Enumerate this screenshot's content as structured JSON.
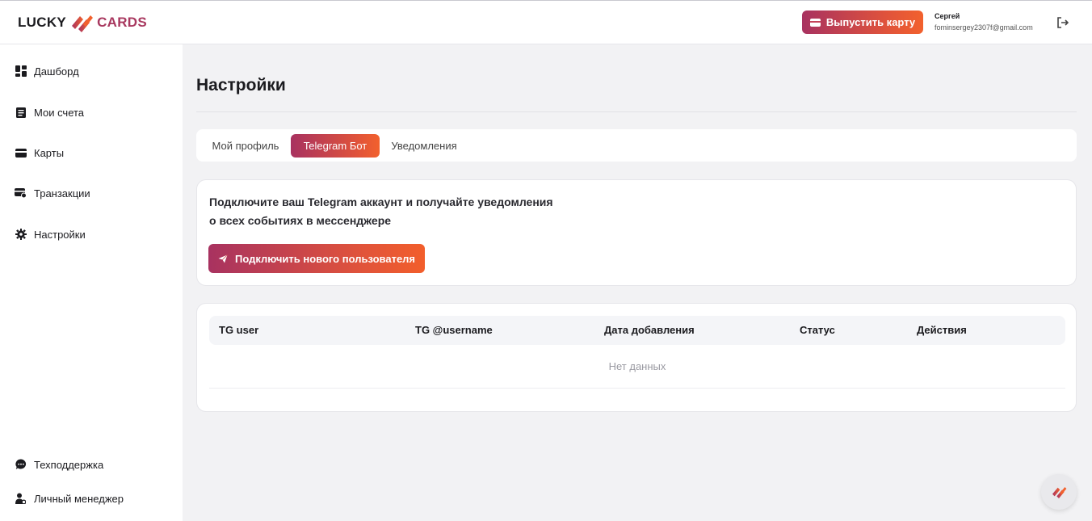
{
  "header": {
    "logo_left": "LUCKY",
    "logo_right": "CARDS",
    "issue_card_label": "Выпустить карту",
    "user_name": "Сергей",
    "user_email": "fominsergey2307f@gmail.com"
  },
  "sidebar": {
    "items": [
      {
        "label": "Дашборд",
        "icon": "dashboard-icon"
      },
      {
        "label": "Мои счета",
        "icon": "accounts-icon"
      },
      {
        "label": "Карты",
        "icon": "card-icon"
      },
      {
        "label": "Транзакции",
        "icon": "transactions-icon"
      },
      {
        "label": "Настройки",
        "icon": "gear-icon"
      }
    ],
    "bottom_items": [
      {
        "label": "Техподдержка",
        "icon": "chat-icon"
      },
      {
        "label": "Личный менеджер",
        "icon": "manager-icon"
      }
    ]
  },
  "main": {
    "title": "Настройки",
    "tabs": [
      {
        "label": "Мой профиль"
      },
      {
        "label": "Telegram Бот"
      },
      {
        "label": "Уведомления"
      }
    ],
    "active_tab": "Telegram Бот",
    "connect": {
      "line1": "Подключите ваш Telegram аккаунт и получайте уведомления",
      "line2": "о всех событиях в мессенджере",
      "button_label": "Подключить нового пользователя"
    },
    "table": {
      "columns": [
        "TG user",
        "TG @username",
        "Дата добавления",
        "Статус",
        "Действия"
      ],
      "empty_text": "Нет данных"
    }
  },
  "colors": {
    "accent_start": "#a83260",
    "accent_end": "#f2612d",
    "background": "#f2f2f4"
  }
}
